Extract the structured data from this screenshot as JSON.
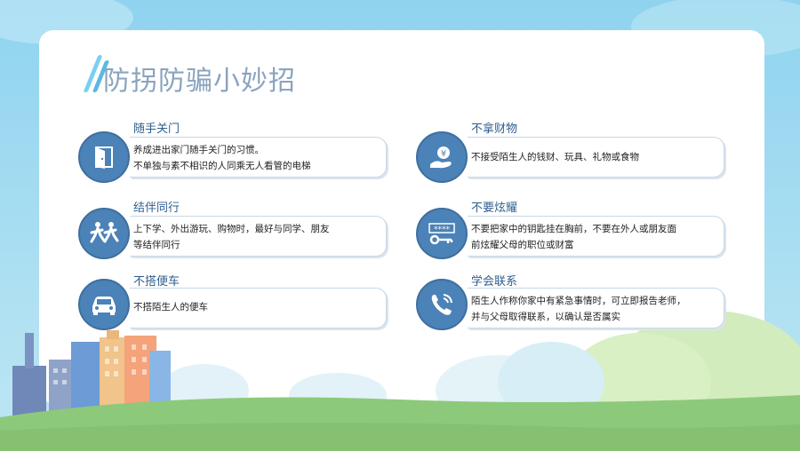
{
  "slide": {
    "title": "防拐防骗小妙招",
    "items": [
      {
        "title": "随手关门",
        "icon": "door-icon",
        "lines": [
          "养成进出家门随手关门的习惯。",
          "不单独与素不相识的人同乘无人看管的电梯"
        ]
      },
      {
        "title": "不拿财物",
        "icon": "money-hand-icon",
        "lines": [
          "不接受陌生人的钱财、玩具、礼物或食物"
        ]
      },
      {
        "title": "结伴同行",
        "icon": "walking-people-icon",
        "lines": [
          "上下学、外出游玩、购物时，最好与同学、朋友",
          "等结伴同行"
        ]
      },
      {
        "title": "不要炫耀",
        "icon": "password-key-icon",
        "lines": [
          "不要把家中的钥匙挂在胸前，不要在外人或朋友面",
          "前炫耀父母的职位或财富"
        ]
      },
      {
        "title": "不搭便车",
        "icon": "car-icon",
        "lines": [
          "不搭陌生人的便车"
        ]
      },
      {
        "title": "学会联系",
        "icon": "phone-icon",
        "lines": [
          "陌生人作称你家中有紧急事情时，可立即报告老师，",
          "并与父母取得联系，以确认是否属实"
        ]
      }
    ]
  },
  "colors": {
    "sky": "#8fd3ef",
    "panel": "#ffffff",
    "icon_circle": "#4b82b7",
    "title_text": "#8aa3bf",
    "item_title": "#2f5f8e",
    "grass": "#8dc97a"
  }
}
